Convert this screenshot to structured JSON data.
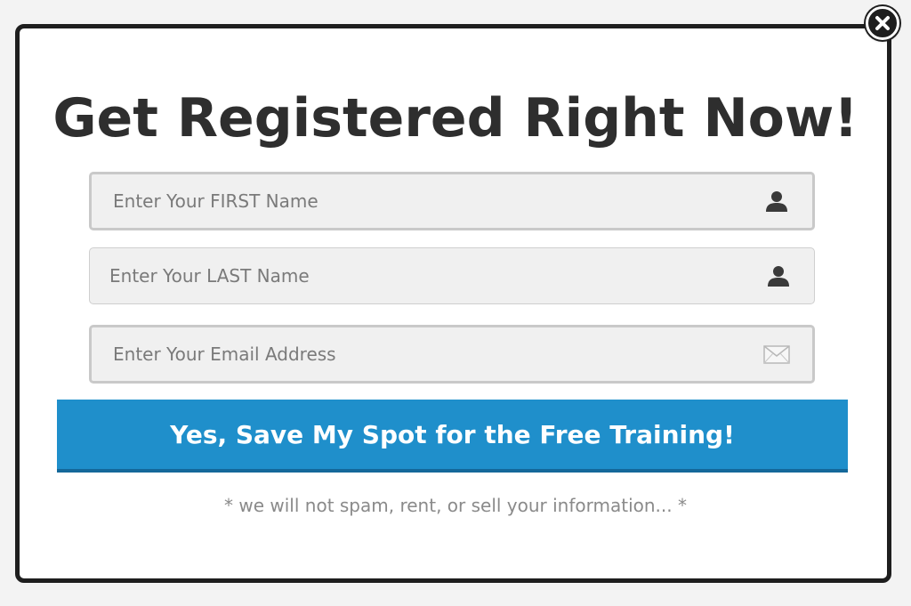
{
  "popup": {
    "title": "Get Registered Right Now!",
    "fields": {
      "first_name_placeholder": "Enter Your FIRST Name",
      "last_name_placeholder": "Enter Your LAST Name",
      "email_placeholder": "Enter Your Email Address"
    },
    "icons": {
      "first_name": "user-icon",
      "last_name": "user-icon",
      "email": "envelope-icon",
      "close": "close-icon"
    },
    "submit_label": "Yes, Save My Spot for the Free Training!",
    "disclaimer": "* we will not spam, rent, or sell your information... *"
  },
  "colors": {
    "accent": "#1f8fcb",
    "frame": "#1e1e1e",
    "title": "#2e2e2e",
    "field_bg": "#f0f0f0"
  }
}
